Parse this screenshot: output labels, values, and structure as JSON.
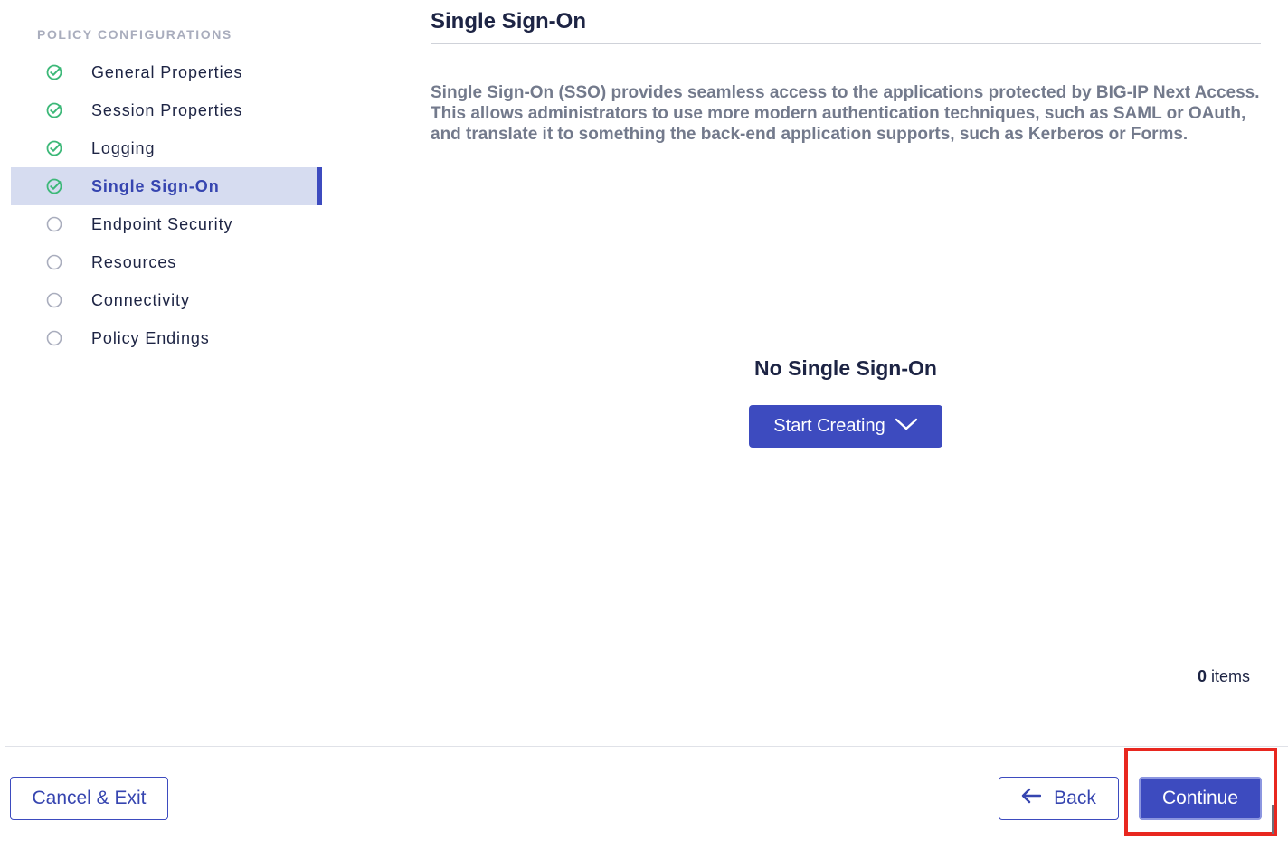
{
  "sidebar": {
    "heading": "POLICY CONFIGURATIONS",
    "steps": [
      {
        "label": "General Properties",
        "status": "complete"
      },
      {
        "label": "Session Properties",
        "status": "complete"
      },
      {
        "label": "Logging",
        "status": "complete"
      },
      {
        "label": "Single Sign-On",
        "status": "complete",
        "active": true
      },
      {
        "label": "Endpoint Security",
        "status": "pending"
      },
      {
        "label": "Resources",
        "status": "pending"
      },
      {
        "label": "Connectivity",
        "status": "pending"
      },
      {
        "label": "Policy Endings",
        "status": "pending"
      }
    ]
  },
  "main": {
    "title": "Single Sign-On",
    "description": "Single Sign-On (SSO) provides seamless access to the applications protected by BIG-IP Next Access. This allows administrators to use more modern authentication techniques, such as SAML or OAuth, and translate it to something the back-end application supports, such as Kerberos or Forms.",
    "empty_state": {
      "title": "No Single Sign-On",
      "button_label": "Start Creating"
    },
    "items_count": {
      "number": "0",
      "suffix": "items"
    }
  },
  "footer": {
    "cancel_label": "Cancel & Exit",
    "back_label": "Back",
    "continue_label": "Continue"
  },
  "colors": {
    "accent": "#3d4bbf",
    "complete_check": "#3cb878",
    "pending_circle": "#a9adbd",
    "highlight": "#e8271f"
  },
  "icons": {
    "complete": "check-circle-icon",
    "pending": "empty-circle-icon",
    "dropdown": "chevron-down-icon",
    "back": "arrow-left-icon"
  }
}
